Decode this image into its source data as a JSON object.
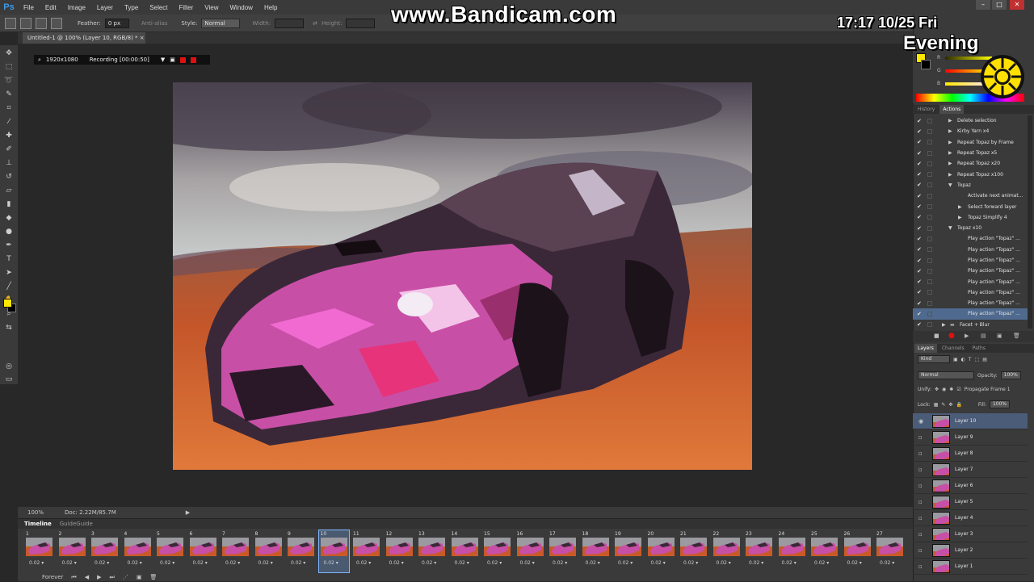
{
  "app": {
    "logo": "Ps"
  },
  "menu": [
    "File",
    "Edit",
    "Image",
    "Layer",
    "Type",
    "Select",
    "Filter",
    "View",
    "Window",
    "Help"
  ],
  "options_bar": {
    "feather_label": "Feather:",
    "feather_value": "0 px",
    "antialias_label": "Anti-alias",
    "style_label": "Style:",
    "style_value": "Normal",
    "width_label": "Width:",
    "height_label": "Height:"
  },
  "document": {
    "tab_title": "Untitled-1 @ 100% (Layer 10, RGB/8) *"
  },
  "recording": {
    "resolution": "1920x1080",
    "status": "Recording [00:00:50]"
  },
  "overlay": {
    "watermark": "www.Bandicam.com",
    "clock": "17:17   10/25  Fri",
    "period": "Evening"
  },
  "status_bar": {
    "zoom": "100%",
    "doc": "Doc: 2.22M/85.7M"
  },
  "timeline": {
    "tabs": [
      "Timeline",
      "GuideGuide"
    ],
    "loop": "Forever",
    "selected_frame": 10,
    "frame_delay": "0.02",
    "frames": [
      1,
      2,
      3,
      4,
      5,
      6,
      7,
      8,
      9,
      10,
      11,
      12,
      13,
      14,
      15,
      16,
      17,
      18,
      19,
      20,
      21,
      22,
      23,
      24,
      25,
      26,
      27
    ]
  },
  "color_panel": {
    "labels": [
      "R",
      "G",
      "B"
    ]
  },
  "actions_panel": {
    "tabs": [
      "History",
      "Actions"
    ],
    "items": [
      {
        "label": "Delete selection",
        "level": 1,
        "tri": "▶"
      },
      {
        "label": "Kirby Yarn x4",
        "level": 1,
        "tri": "▶"
      },
      {
        "label": "Repeat Topaz by Frame",
        "level": 1,
        "tri": "▶"
      },
      {
        "label": "Repeat Topaz x5",
        "level": 1,
        "tri": "▶"
      },
      {
        "label": "Repeat Topaz x20",
        "level": 1,
        "tri": "▶"
      },
      {
        "label": "Repeat Topaz x100",
        "level": 1,
        "tri": "▶"
      },
      {
        "label": "Topaz",
        "level": 1,
        "tri": "▼"
      },
      {
        "label": "Activate next animat...",
        "level": 2,
        "tri": ""
      },
      {
        "label": "Select forward layer",
        "level": 2,
        "tri": "▶"
      },
      {
        "label": "Topaz Simplify 4",
        "level": 2,
        "tri": "▶"
      },
      {
        "label": "Topaz x10",
        "level": 1,
        "tri": "▼"
      },
      {
        "label": "Play action \"Topaz\" ...",
        "level": 2,
        "tri": ""
      },
      {
        "label": "Play action \"Topaz\" ...",
        "level": 2,
        "tri": ""
      },
      {
        "label": "Play action \"Topaz\" ...",
        "level": 2,
        "tri": ""
      },
      {
        "label": "Play action \"Topaz\" ...",
        "level": 2,
        "tri": ""
      },
      {
        "label": "Play action \"Topaz\" ...",
        "level": 2,
        "tri": ""
      },
      {
        "label": "Play action \"Topaz\" ...",
        "level": 2,
        "tri": ""
      },
      {
        "label": "Play action \"Topaz\" ...",
        "level": 2,
        "tri": ""
      },
      {
        "label": "Play action \"Topaz\" ...",
        "level": 2,
        "tri": "",
        "selected": true
      },
      {
        "label": "Facet + Blur",
        "level": 0,
        "tri": "▶"
      }
    ]
  },
  "layers_panel": {
    "tabs": [
      "Layers",
      "Channels",
      "Paths"
    ],
    "kind": "Kind",
    "blend_mode": "Normal",
    "opacity_label": "Opacity:",
    "opacity_value": "100%",
    "unify_label": "Unify:",
    "propagate_label": "Propagate Frame 1",
    "lock_label": "Lock:",
    "fill_label": "Fill:",
    "fill_value": "100%",
    "layers": [
      "Layer 10",
      "Layer 9",
      "Layer 8",
      "Layer 7",
      "Layer 6",
      "Layer 5",
      "Layer 4",
      "Layer 3",
      "Layer 2",
      "Layer 1"
    ]
  }
}
